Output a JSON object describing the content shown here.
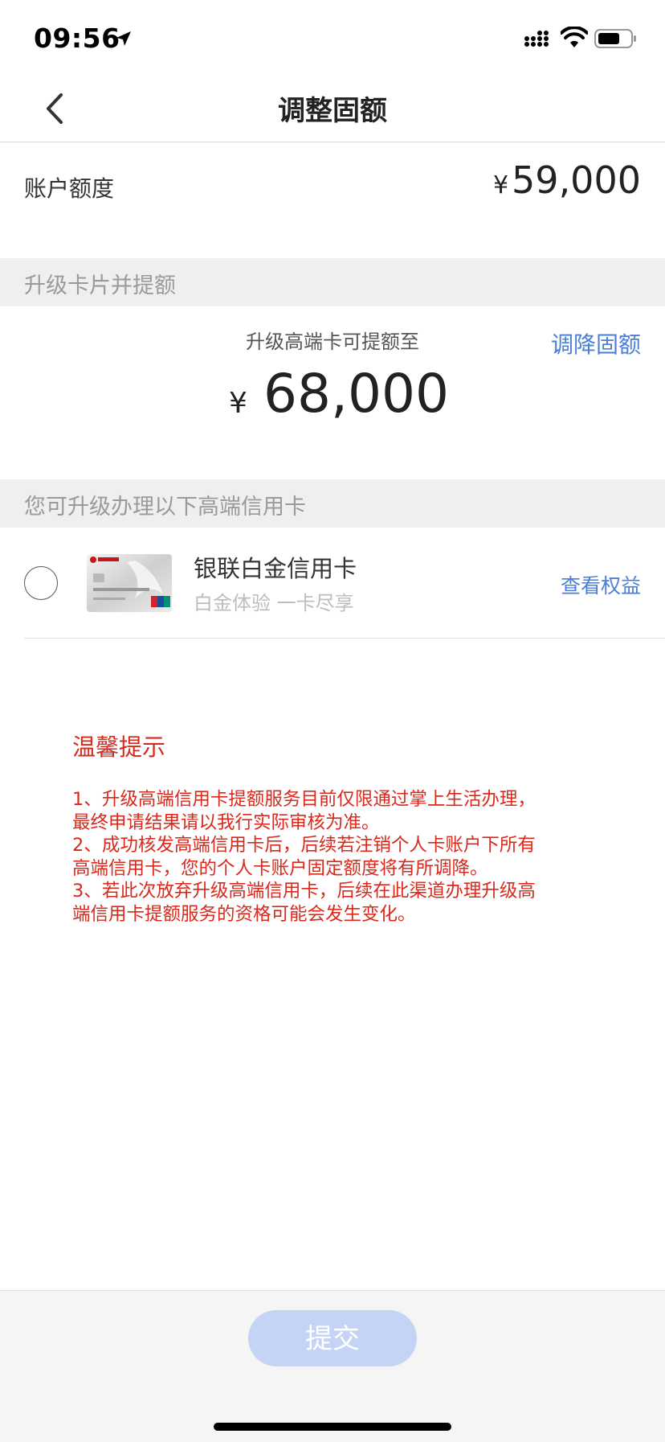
{
  "status_bar": {
    "time": "09:56"
  },
  "nav": {
    "title": "调整固额"
  },
  "account": {
    "label": "账户额度",
    "currency": "¥",
    "amount": "59,000"
  },
  "upgrade_section": {
    "header": "升级卡片并提额",
    "hint": "升级高端卡可提额至",
    "link": "调降固额",
    "currency": "¥",
    "amount": "68,000"
  },
  "cards_section": {
    "header": "您可升级办理以下高端信用卡",
    "card": {
      "name": "银联白金信用卡",
      "subtitle": "白金体验 一卡尽享",
      "link": "查看权益"
    }
  },
  "tips": {
    "title": "温馨提示",
    "lines": [
      "1、升级高端信用卡提额服务目前仅限通过掌上生活办理，",
      "最终申请结果请以我行实际审核为准。",
      "2、成功核发高端信用卡后，后续若注销个人卡账户下所有",
      "高端信用卡，您的个人卡账户固定额度将有所调降。",
      "3、若此次放弃升级高端信用卡，后续在此渠道办理升级高",
      "端信用卡提额服务的资格可能会发生变化。"
    ]
  },
  "footer": {
    "submit_label": "提交"
  },
  "colors": {
    "accent_blue": "#4a7ed8",
    "warning_red": "#d9291c",
    "button_disabled": "#c5d4f5"
  }
}
